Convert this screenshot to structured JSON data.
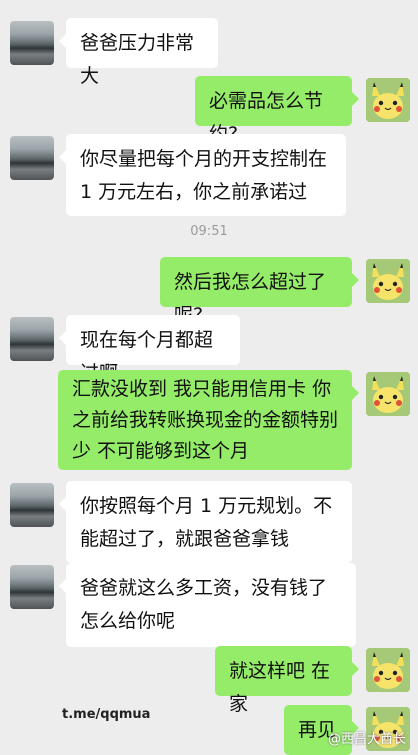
{
  "messages": [
    {
      "side": "left",
      "avatar": "father-avatar",
      "text": "爸爸压力非常大"
    },
    {
      "side": "right",
      "avatar": "pikachu-avatar",
      "text": "必需品怎么节约?"
    },
    {
      "side": "left",
      "avatar": "father-avatar",
      "text": "你尽量把每个月的开支控制在 1 万元左右，你之前承诺过"
    },
    {
      "side": "right",
      "avatar": "pikachu-avatar",
      "text": "然后我怎么超过了呢?"
    },
    {
      "side": "left",
      "avatar": "father-avatar",
      "text": "现在每个月都超过啊"
    },
    {
      "side": "right",
      "avatar": "pikachu-avatar",
      "text": "汇款没收到 我只能用信用卡 你之前给我转账换现金的金额特别少 不可能够到这个月"
    },
    {
      "side": "left",
      "avatar": "father-avatar",
      "text": "你按照每个月 1 万元规划。不能超过了，就跟爸爸拿钱"
    },
    {
      "side": "left",
      "avatar": "father-avatar",
      "text": "爸爸就这么多工资，没有钱了怎么给你呢"
    },
    {
      "side": "right",
      "avatar": "pikachu-avatar",
      "text": "就这样吧 在家"
    },
    {
      "side": "right",
      "avatar": "pikachu-avatar",
      "text": "再见"
    }
  ],
  "timestamp": "09:51",
  "source_label": "t.me/qqmua",
  "watermark": "@西昌大酋长",
  "colors": {
    "sent_bubble": "#95ec69",
    "received_bubble": "#ffffff",
    "background": "#ededed"
  }
}
